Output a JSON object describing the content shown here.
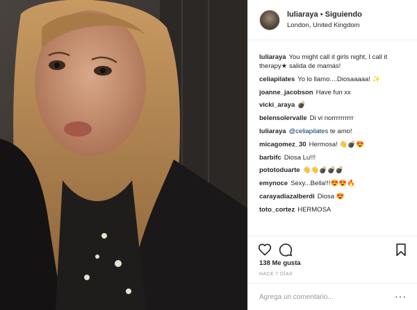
{
  "post": {
    "username": "luliaraya",
    "separator": "•",
    "follow_status": "Siguiendo",
    "location": "London, United Kingdom",
    "likes": "138 Me gusta",
    "time_ago": "HACE 7 DÍAS",
    "comment_placeholder": "Agrega un comentario...",
    "more_label": "···"
  },
  "comments": [
    {
      "user": "luliaraya",
      "text": "You might call it girls night, I call it therapy★ salida de mamás!"
    },
    {
      "user": "celiapilates",
      "text": "Yo lo llamo....Diosaaaaa! ✨"
    },
    {
      "user": "joanne_jacobson",
      "text": "Have fun xx"
    },
    {
      "user": "vicki_araya",
      "text": "💣"
    },
    {
      "user": "belensolervalle",
      "text": "Di vi norrrrrrrrrr"
    },
    {
      "user": "luliaraya",
      "mention": "@celiapilates",
      "text": "te amo!"
    },
    {
      "user": "micagomez_30",
      "text": "Hermosa! 👋💣😍"
    },
    {
      "user": "barbifc",
      "text": "Diosa Lu!!!"
    },
    {
      "user": "pototoduarte",
      "text": "👋👋💣💣💣"
    },
    {
      "user": "emynoce",
      "text": "Sexy...Bella!!!😍😍🔥"
    },
    {
      "user": "carayadiazalberdi",
      "text": "Diosa 😍"
    },
    {
      "user": "toto_cortez",
      "text": "HERMOSA"
    }
  ],
  "icons": {
    "like": "heart-icon",
    "comment": "comment-bubble-icon",
    "save": "bookmark-icon"
  },
  "colors": {
    "text": "#262626",
    "muted": "#999999",
    "border": "#efefef",
    "mention": "#003569"
  }
}
